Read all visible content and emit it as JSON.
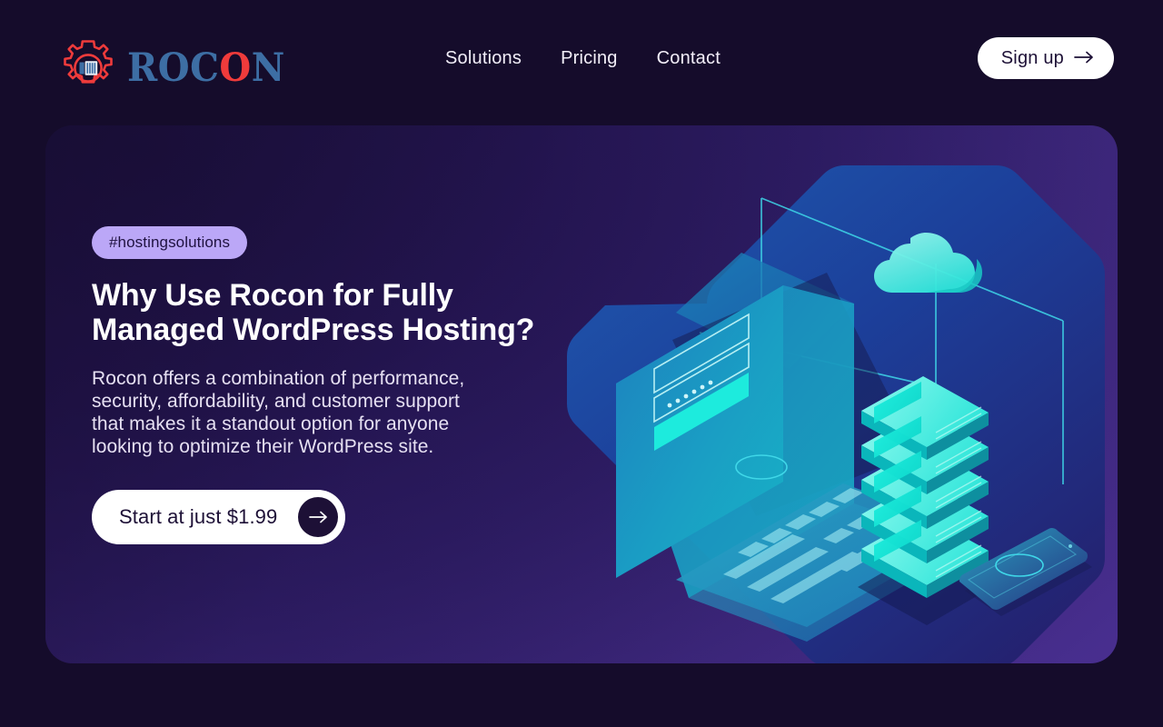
{
  "brand": {
    "name_primary": "ROC",
    "name_accent": "O",
    "name_tail": "N",
    "full_name": "ROCON",
    "gear_icon": "gear-server-icon",
    "gear_color": "#ef3b3b",
    "word_color": "#3d6ea4",
    "accent_color": "#ef3b3b"
  },
  "nav": {
    "items": [
      {
        "label": "Solutions"
      },
      {
        "label": "Pricing"
      },
      {
        "label": "Contact"
      }
    ]
  },
  "signup": {
    "label": "Sign up",
    "arrow_icon": "arrow-right-icon",
    "background": "#ffffff",
    "text_color": "#1d1036"
  },
  "hero": {
    "tag": {
      "label": "#hostingsolutions",
      "background": "#bba7f7",
      "text_color": "#1f1240"
    },
    "title": "Why Use Rocon for Fully Managed WordPress Hosting?",
    "description": "Rocon offers a combination of performance, security, affordability, and customer support that makes it a standout option for anyone looking to optimize their WordPress site.",
    "cta": {
      "label": "Start at just $1.99",
      "arrow_icon": "arrow-right-icon",
      "background": "#ffffff",
      "text_color": "#1d1036",
      "circle_color": "#1d1036"
    },
    "card_gradient_from": "#1d1140",
    "card_gradient_to": "#462d8c"
  },
  "illustration": {
    "name": "isometric-cloud-hosting-illustration",
    "backdrop_shape": "octagon",
    "backdrop_from": "#1d4f9e",
    "backdrop_to": "#1a2c83",
    "accent_glow": "#2ff3e0",
    "elements": [
      {
        "name": "laptop-device",
        "detail": "isometric laptop with login form on screen"
      },
      {
        "name": "server-rack",
        "detail": "glowing stacked server units",
        "units": 5
      },
      {
        "name": "cloud-icon",
        "detail": "cloud resting on top of server rack"
      },
      {
        "name": "phone-device",
        "detail": "isometric smartphone"
      },
      {
        "name": "connection-lines",
        "detail": "thin cyan lines linking laptop, server and phone"
      }
    ]
  },
  "page": {
    "background": "#150c2b"
  }
}
